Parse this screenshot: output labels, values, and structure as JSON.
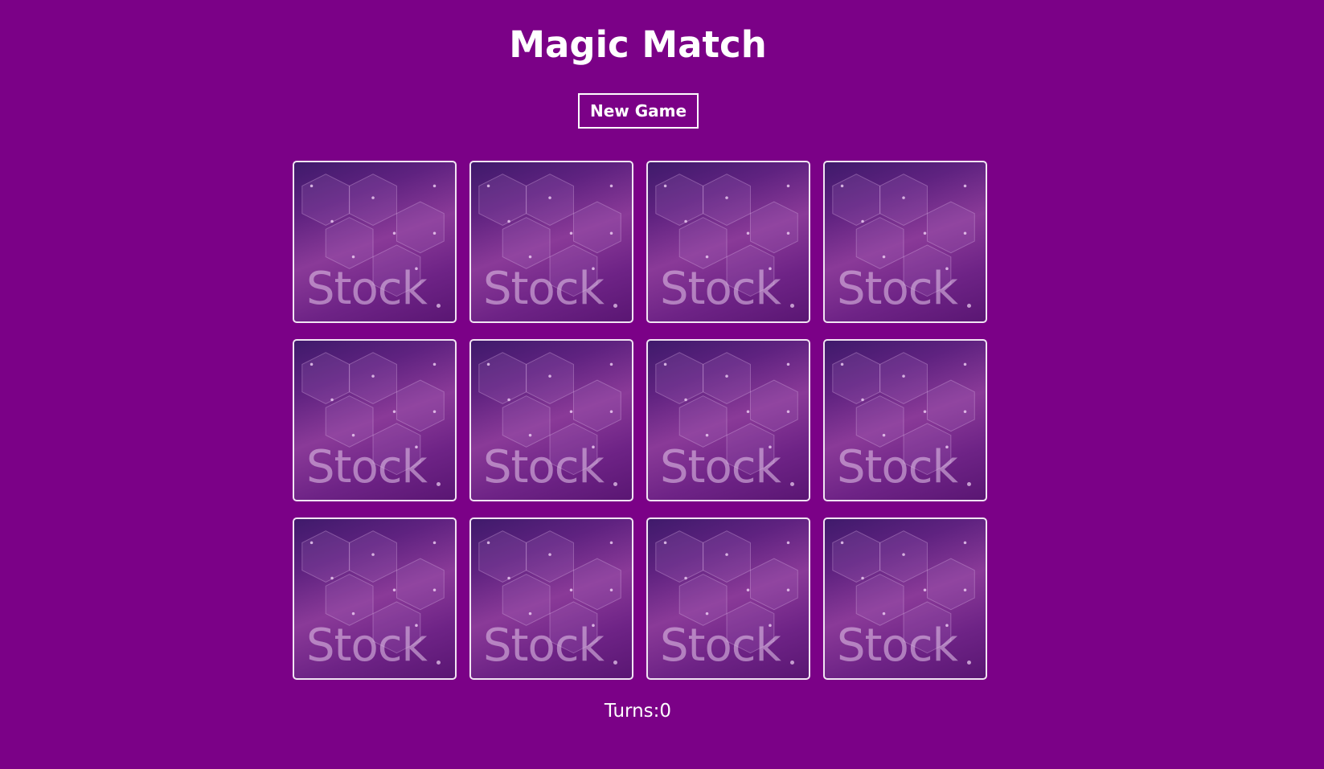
{
  "game": {
    "title": "Magic Match",
    "new_game_label": "New Game",
    "turns_label": "Turns:",
    "turns_value": "0"
  },
  "cards": [
    {
      "face": "back",
      "back_text": "Stock"
    },
    {
      "face": "back",
      "back_text": "Stock"
    },
    {
      "face": "back",
      "back_text": "Stock"
    },
    {
      "face": "back",
      "back_text": "Stock"
    },
    {
      "face": "back",
      "back_text": "Stock"
    },
    {
      "face": "back",
      "back_text": "Stock"
    },
    {
      "face": "back",
      "back_text": "Stock"
    },
    {
      "face": "back",
      "back_text": "Stock"
    },
    {
      "face": "back",
      "back_text": "Stock"
    },
    {
      "face": "back",
      "back_text": "Stock"
    },
    {
      "face": "back",
      "back_text": "Stock"
    },
    {
      "face": "back",
      "back_text": "Stock"
    }
  ],
  "colors": {
    "background": "#7b0187",
    "text": "#ffffff",
    "card_border": "#f1e4f3"
  }
}
